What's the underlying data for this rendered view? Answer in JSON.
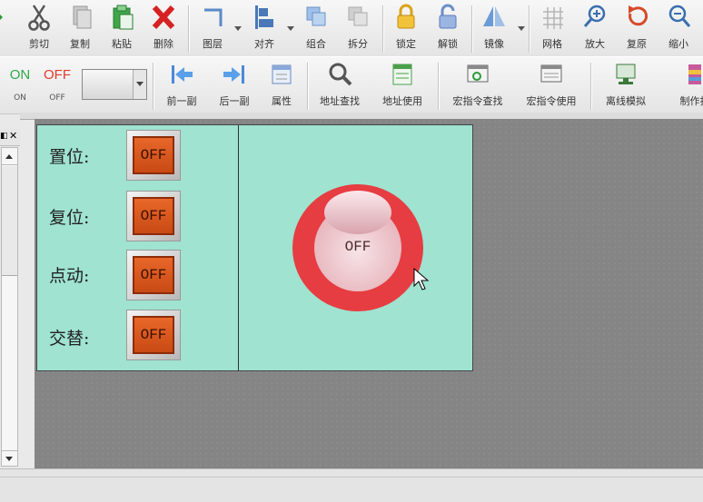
{
  "toolbar1": {
    "items": [
      {
        "label": "剪切",
        "icon": "scissors-icon"
      },
      {
        "label": "复制",
        "icon": "copy-icon"
      },
      {
        "label": "粘贴",
        "icon": "paste-icon"
      },
      {
        "label": "删除",
        "icon": "delete-icon"
      },
      {
        "label": "图层",
        "icon": "layer-icon"
      },
      {
        "label": "对齐",
        "icon": "align-icon"
      },
      {
        "label": "组合",
        "icon": "group-icon"
      },
      {
        "label": "拆分",
        "icon": "ungroup-icon"
      },
      {
        "label": "锁定",
        "icon": "lock-icon"
      },
      {
        "label": "解锁",
        "icon": "unlock-icon"
      },
      {
        "label": "镜像",
        "icon": "mirror-icon"
      },
      {
        "label": "网格",
        "icon": "grid-icon"
      },
      {
        "label": "放大",
        "icon": "zoom-in-icon"
      },
      {
        "label": "复原",
        "icon": "restore-icon"
      },
      {
        "label": "缩小",
        "icon": "zoom-out-icon"
      }
    ]
  },
  "toolbar2": {
    "on_icon_text": "ON",
    "on_label": "ON",
    "off_icon_text": "OFF",
    "off_label": "OFF",
    "items": [
      {
        "label": "前一副",
        "icon": "prev-screen-icon"
      },
      {
        "label": "后一副",
        "icon": "next-screen-icon"
      },
      {
        "label": "属性",
        "icon": "properties-icon"
      },
      {
        "label": "地址查找",
        "icon": "address-search-icon"
      },
      {
        "label": "地址使用",
        "icon": "address-usage-icon"
      },
      {
        "label": "宏指令查找",
        "icon": "macro-search-icon"
      },
      {
        "label": "宏指令使用",
        "icon": "macro-usage-icon"
      },
      {
        "label": "离线模拟",
        "icon": "offline-sim-icon"
      },
      {
        "label": "制作打",
        "icon": "package-icon"
      }
    ]
  },
  "screen": {
    "rows": [
      {
        "label": "置位:",
        "button_text": "OFF"
      },
      {
        "label": "复位:",
        "button_text": "OFF"
      },
      {
        "label": "点动:",
        "button_text": "OFF"
      },
      {
        "label": "交替:",
        "button_text": "OFF"
      }
    ],
    "lamp_text": "OFF"
  },
  "colors": {
    "screen_bg": "#9fe3d0",
    "button_face": "#e8672a",
    "lamp_ring": "#e63d42",
    "on_green": "#2fa84a",
    "off_red": "#e23a2a"
  }
}
